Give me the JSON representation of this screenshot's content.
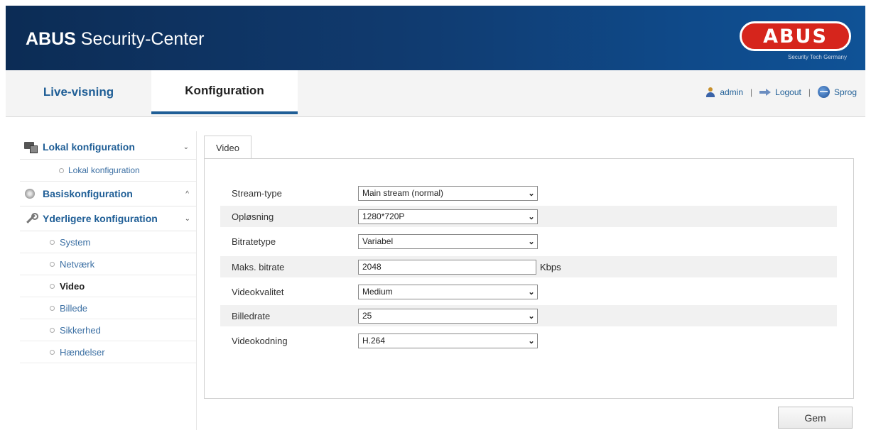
{
  "header": {
    "title_bold": "ABUS",
    "title_rest": "Security-Center",
    "logo_text": "ABUS",
    "logo_tagline": "Security Tech Germany"
  },
  "nav": {
    "tabs": [
      {
        "label": "Live-visning",
        "active": false
      },
      {
        "label": "Konfiguration",
        "active": true
      }
    ],
    "user": "admin",
    "logout": "Logout",
    "language": "Sprog",
    "separator": "|"
  },
  "sidebar": {
    "local_group": {
      "label": "Lokal konfiguration",
      "chevron": "⌄",
      "icon": "monitor-icon"
    },
    "local_item": "Lokal konfiguration",
    "basic_group": {
      "label": "Basiskonfiguration",
      "chevron": "^",
      "icon": "disc-icon"
    },
    "advanced_group": {
      "label": "Yderligere konfiguration",
      "chevron": "⌄",
      "icon": "wrench-icon"
    },
    "items": [
      {
        "label": "System",
        "active": false
      },
      {
        "label": "Netværk",
        "active": false
      },
      {
        "label": "Video",
        "active": true
      },
      {
        "label": "Billede",
        "active": false
      },
      {
        "label": "Sikkerhed",
        "active": false
      },
      {
        "label": "Hændelser",
        "active": false
      }
    ]
  },
  "content": {
    "tab": "Video",
    "fields": {
      "stream_type": {
        "label": "Stream-type",
        "value": "Main stream (normal)"
      },
      "resolution": {
        "label": "Opløsning",
        "value": "1280*720P"
      },
      "bitrate_type": {
        "label": "Bitratetype",
        "value": "Variabel"
      },
      "max_bitrate": {
        "label": "Maks. bitrate",
        "value": "2048",
        "unit": "Kbps"
      },
      "video_quality": {
        "label": "Videokvalitet",
        "value": "Medium"
      },
      "frame_rate": {
        "label": "Billedrate",
        "value": "25"
      },
      "video_encoding": {
        "label": "Videokodning",
        "value": "H.264"
      }
    },
    "save_label": "Gem"
  },
  "colors": {
    "header_start": "#0c2c55",
    "header_end": "#0f5296",
    "accent": "#1f5e96",
    "logo_red": "#d6251c"
  }
}
